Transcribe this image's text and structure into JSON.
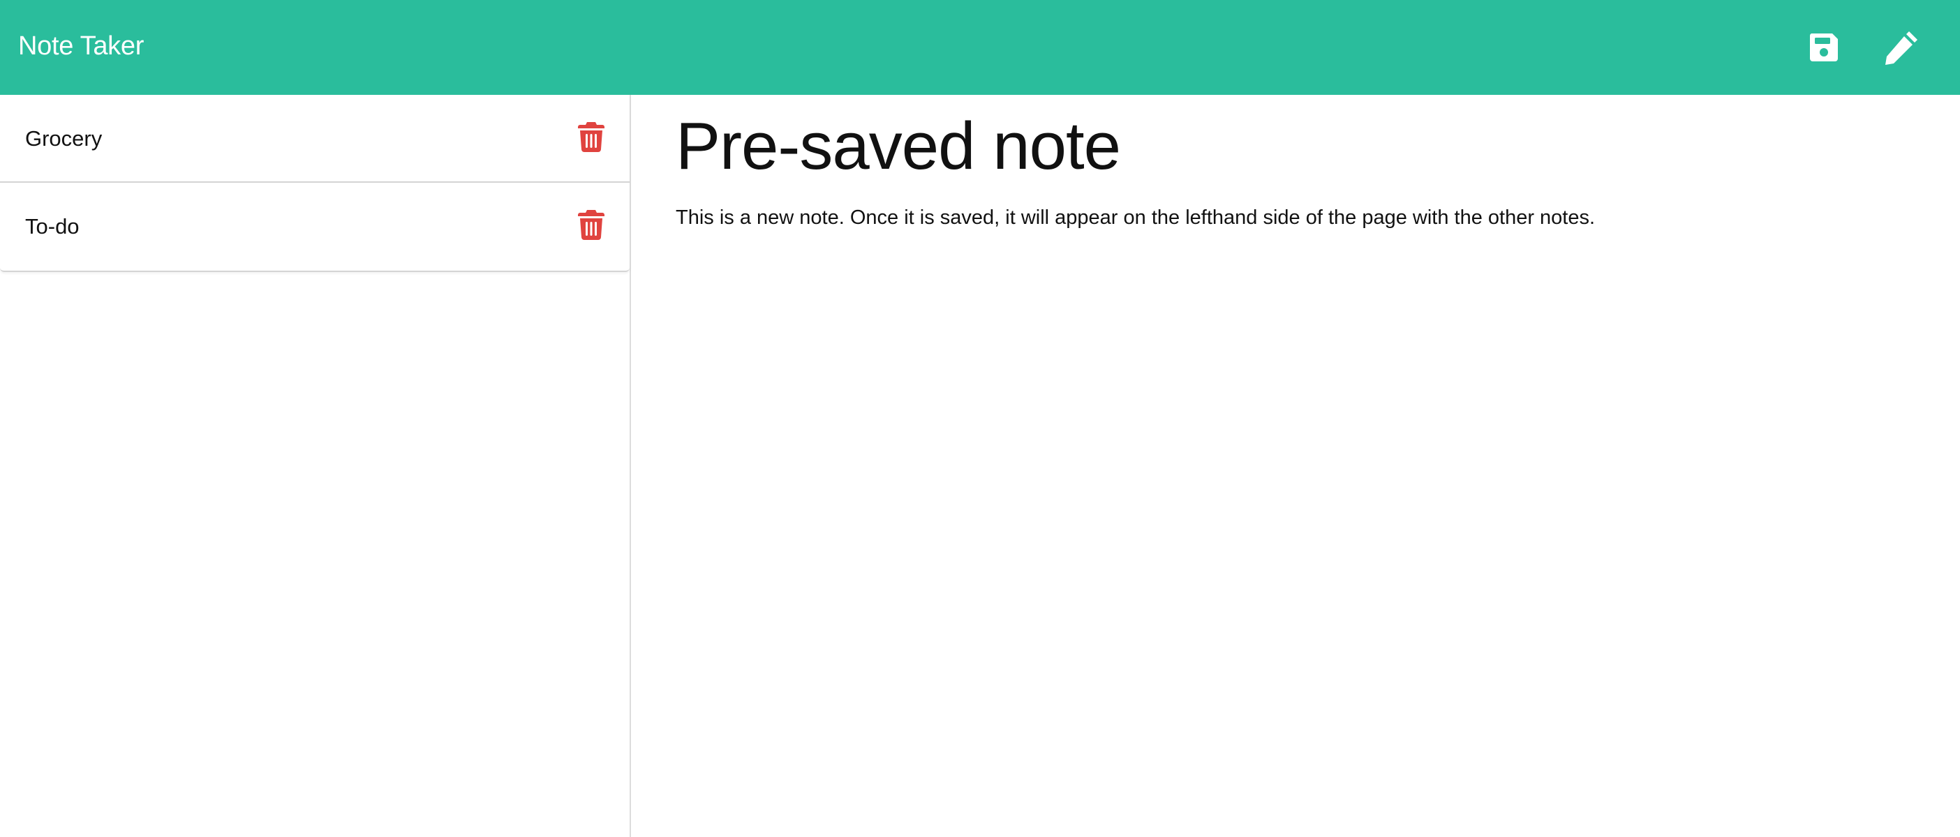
{
  "app": {
    "title": "Note Taker",
    "accent_color": "#2abd9c",
    "delete_color": "#e0433f"
  },
  "toolbar": {
    "save_icon": "floppy-disk-icon",
    "write_icon": "pencil-icon"
  },
  "sidebar": {
    "notes": [
      {
        "title": "Grocery",
        "icon": "trash-icon"
      },
      {
        "title": "To-do",
        "icon": "trash-icon"
      }
    ]
  },
  "editor": {
    "title": "Pre-saved note",
    "text": "This is a new note. Once it is saved, it will appear on the lefthand side of the page with the other notes."
  }
}
